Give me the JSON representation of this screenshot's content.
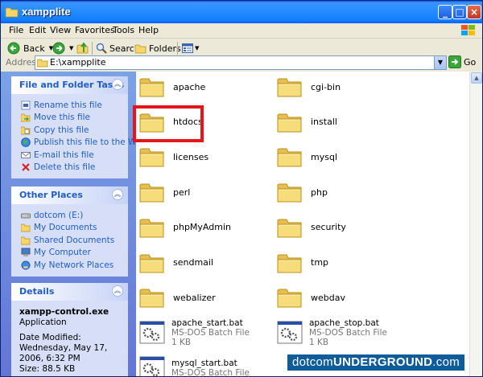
{
  "window": {
    "title": "xampplite"
  },
  "menu": [
    "File",
    "Edit",
    "View",
    "Favorites",
    "Tools",
    "Help"
  ],
  "toolbar": {
    "back": "Back",
    "search": "Search",
    "folders": "Folders"
  },
  "address": {
    "label": "Address",
    "value": "E:\\xampplite",
    "go": "Go"
  },
  "tasks": {
    "file_folder": {
      "title": "File and Folder Tasks",
      "items": [
        "Rename this file",
        "Move this file",
        "Copy this file",
        "Publish this file to the Web",
        "E-mail this file",
        "Delete this file"
      ]
    },
    "other_places": {
      "title": "Other Places",
      "items": [
        "dotcom (E:)",
        "My Documents",
        "Shared Documents",
        "My Computer",
        "My Network Places"
      ]
    },
    "details": {
      "title": "Details",
      "name": "xampp-control.exe",
      "type": "Application",
      "modified": "Date Modified: Wednesday, May 17, 2006, 6:32 PM",
      "size": "Size: 88.5 KB"
    }
  },
  "folders": [
    "apache",
    "cgi-bin",
    "htdocs",
    "install",
    "licenses",
    "mysql",
    "perl",
    "php",
    "phpMyAdmin",
    "security",
    "sendmail",
    "tmp",
    "webalizer",
    "webdav"
  ],
  "files": [
    {
      "name": "apache_start.bat",
      "type": "MS-DOS Batch File",
      "size": "1 KB"
    },
    {
      "name": "apache_stop.bat",
      "type": "MS-DOS Batch File",
      "size": "1 KB"
    },
    {
      "name": "mysql_start.bat",
      "type": "MS-DOS Batch File",
      "size": ""
    }
  ],
  "watermark": {
    "a": "dotcom",
    "b": "UNDERGROUND",
    "c": ".com"
  }
}
